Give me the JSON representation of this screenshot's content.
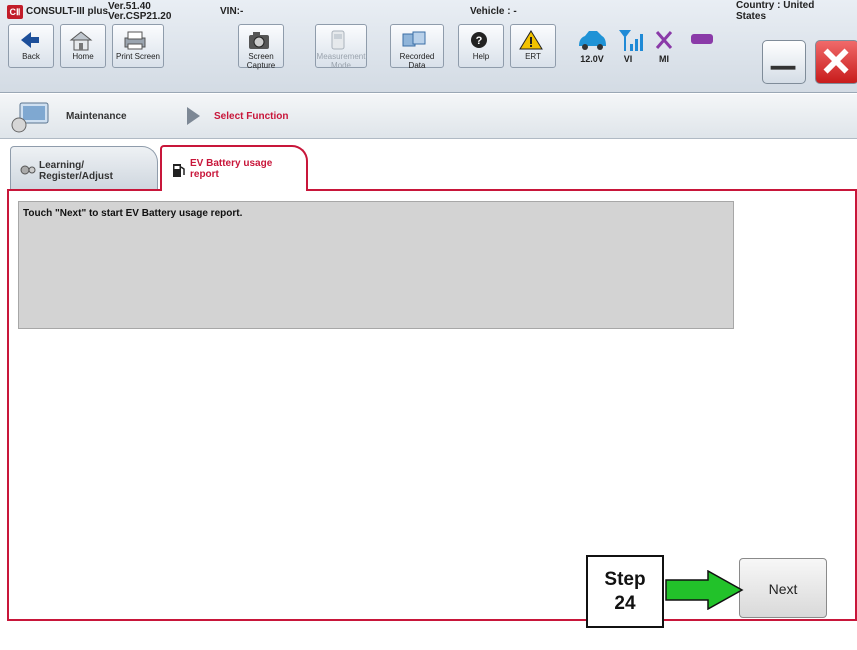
{
  "header": {
    "app_name": "CONSULT-III plus",
    "logo_text": "CⅡ",
    "version_1": "Ver.51.40",
    "version_2": "Ver.CSP21.20",
    "vin": "VIN:-",
    "vehicle": "Vehicle : -",
    "country": "Country : United States"
  },
  "toolbar": [
    {
      "label": "Back",
      "icon": "back-arrow-icon"
    },
    {
      "label": "Home",
      "icon": "home-icon"
    },
    {
      "label": "Print Screen",
      "icon": "printer-icon"
    },
    {
      "label": "Screen Capture",
      "icon": "camera-icon"
    },
    {
      "label": "Measurement Mode",
      "icon": "measurement-icon",
      "disabled": true
    },
    {
      "label": "Recorded Data",
      "icon": "recorded-data-icon"
    },
    {
      "label": "Help",
      "icon": "help-icon"
    },
    {
      "label": "ERT",
      "icon": "warning-icon"
    }
  ],
  "status": {
    "battery": "12.0V",
    "vi": "VI",
    "mi": "MI"
  },
  "breadcrumb": {
    "item_1": "Maintenance",
    "item_2": "Select Function"
  },
  "tabs": [
    {
      "label": "Learning/ Register/Adjust",
      "line1": "Learning/",
      "line2": "Register/Adjust"
    },
    {
      "label": "EV Battery usage report",
      "line1": "EV Battery usage",
      "line2": "report",
      "active": true
    }
  ],
  "message": "Touch \"Next\" to start EV Battery usage report.",
  "next_label": "Next",
  "step": {
    "line1": "Step",
    "line2": "24"
  },
  "colors": {
    "accent": "#c8163a",
    "arrow": "#22c22a"
  }
}
